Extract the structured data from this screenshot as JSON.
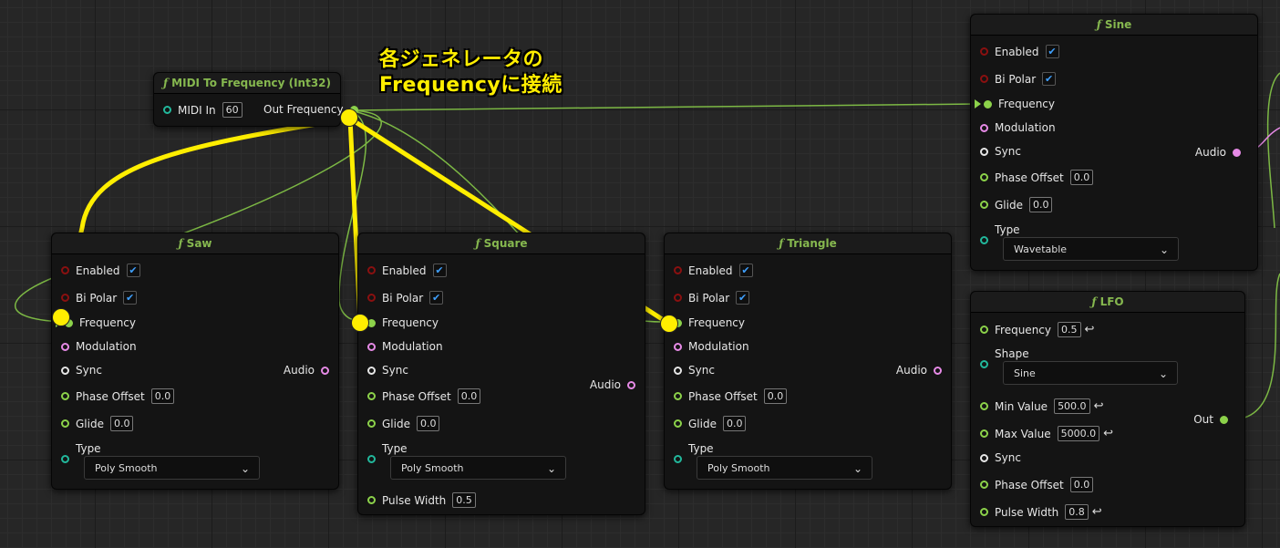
{
  "annotation": {
    "line1": "各ジェネレータの",
    "line2": "Frequencyに接続"
  },
  "midi_node": {
    "title": "MIDI To Frequency (Int32)",
    "midi_in_label": "MIDI In",
    "midi_in_value": "60",
    "out_label": "Out Frequency"
  },
  "saw": {
    "title": "Saw",
    "enabled": "Enabled",
    "bipolar": "Bi Polar",
    "frequency": "Frequency",
    "modulation": "Modulation",
    "sync": "Sync",
    "phase_offset": "Phase Offset",
    "phase_value": "0.0",
    "glide": "Glide",
    "glide_value": "0.0",
    "type": "Type",
    "type_value": "Poly Smooth",
    "audio": "Audio"
  },
  "square": {
    "title": "Square",
    "enabled": "Enabled",
    "bipolar": "Bi Polar",
    "frequency": "Frequency",
    "modulation": "Modulation",
    "sync": "Sync",
    "phase_offset": "Phase Offset",
    "phase_value": "0.0",
    "glide": "Glide",
    "glide_value": "0.0",
    "type": "Type",
    "type_value": "Poly Smooth",
    "pulse_width": "Pulse Width",
    "pulse_value": "0.5",
    "audio": "Audio"
  },
  "triangle": {
    "title": "Triangle",
    "enabled": "Enabled",
    "bipolar": "Bi Polar",
    "frequency": "Frequency",
    "modulation": "Modulation",
    "sync": "Sync",
    "phase_offset": "Phase Offset",
    "phase_value": "0.0",
    "glide": "Glide",
    "glide_value": "0.0",
    "type": "Type",
    "type_value": "Poly Smooth",
    "audio": "Audio"
  },
  "sine": {
    "title": "Sine",
    "enabled": "Enabled",
    "bipolar": "Bi Polar",
    "frequency": "Frequency",
    "modulation": "Modulation",
    "sync": "Sync",
    "phase_offset": "Phase Offset",
    "phase_value": "0.0",
    "glide": "Glide",
    "glide_value": "0.0",
    "type": "Type",
    "type_value": "Wavetable",
    "audio": "Audio"
  },
  "lfo": {
    "title": "LFO",
    "frequency": "Frequency",
    "frequency_value": "0.5",
    "shape": "Shape",
    "shape_value": "Sine",
    "min_value": "Min Value",
    "min_value_value": "500.0",
    "max_value": "Max Value",
    "max_value_value": "5000.0",
    "sync": "Sync",
    "phase_offset": "Phase Offset",
    "phase_value": "0.0",
    "pulse_width": "Pulse Width",
    "pulse_value": "0.8",
    "out": "Out"
  },
  "colors": {
    "wire_float": "#8cd24a",
    "wire_audio": "#e68ae6",
    "annotation": "#ffee00",
    "header_text": "#86b84f"
  },
  "icons": [
    "function-icon",
    "checkbox-check-icon",
    "chevron-down-icon",
    "reset-arrow-icon",
    "exec-arrow-icon"
  ]
}
